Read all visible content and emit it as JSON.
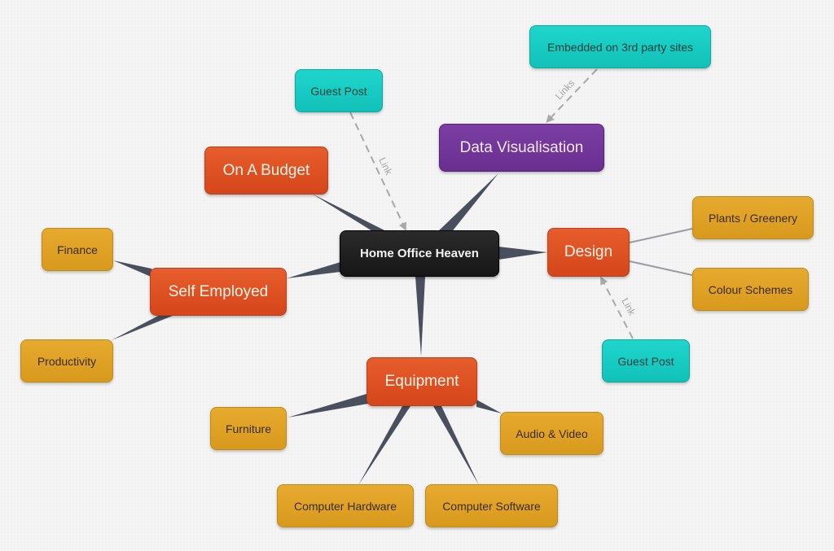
{
  "title": "Home Office Heaven",
  "colors": {
    "root": "#1f1f1f",
    "main_branch": "#e0531f",
    "purple_branch": "#6f3296",
    "leaf": "#e0a126",
    "link_node": "#17ccc2",
    "connector": "#4a4f5e",
    "dashed_link": "#a8a8a8"
  },
  "nodes": {
    "root": {
      "label": "Home Office Heaven"
    },
    "on_a_budget": {
      "label": "On A Budget"
    },
    "data_visualisation": {
      "label": "Data Visualisation"
    },
    "design": {
      "label": "Design"
    },
    "self_employed": {
      "label": "Self Employed"
    },
    "equipment": {
      "label": "Equipment"
    },
    "finance": {
      "label": "Finance"
    },
    "productivity": {
      "label": "Productivity"
    },
    "plants_greenery": {
      "label": "Plants / Greenery"
    },
    "colour_schemes": {
      "label": "Colour Schemes"
    },
    "furniture": {
      "label": "Furniture"
    },
    "audio_video": {
      "label": "Audio & Video"
    },
    "computer_hardware": {
      "label": "Computer Hardware"
    },
    "computer_software": {
      "label": "Computer Software"
    },
    "guest_post_top": {
      "label": "Guest Post"
    },
    "embedded_sites": {
      "label": "Embedded on 3rd party sites"
    },
    "guest_post_design": {
      "label": "Guest Post"
    }
  },
  "links": {
    "guest_post_top_to_root": "Link",
    "embedded_to_data_vis": "Links",
    "guest_post_design_to_design": "Link"
  }
}
